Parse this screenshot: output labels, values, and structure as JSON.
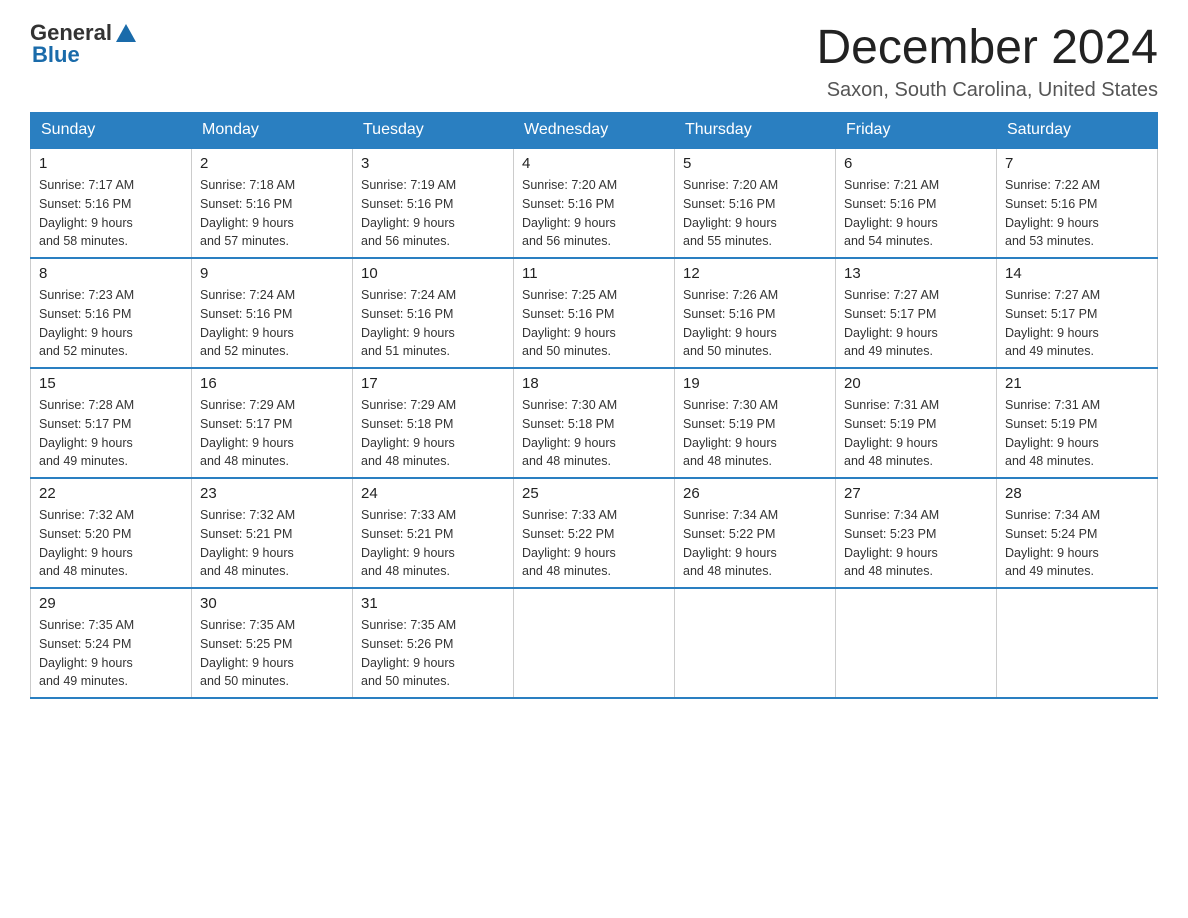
{
  "logo": {
    "general": "General",
    "blue": "Blue"
  },
  "title": "December 2024",
  "location": "Saxon, South Carolina, United States",
  "weekdays": [
    "Sunday",
    "Monday",
    "Tuesday",
    "Wednesday",
    "Thursday",
    "Friday",
    "Saturday"
  ],
  "weeks": [
    [
      {
        "day": "1",
        "sunrise": "7:17 AM",
        "sunset": "5:16 PM",
        "daylight": "9 hours and 58 minutes."
      },
      {
        "day": "2",
        "sunrise": "7:18 AM",
        "sunset": "5:16 PM",
        "daylight": "9 hours and 57 minutes."
      },
      {
        "day": "3",
        "sunrise": "7:19 AM",
        "sunset": "5:16 PM",
        "daylight": "9 hours and 56 minutes."
      },
      {
        "day": "4",
        "sunrise": "7:20 AM",
        "sunset": "5:16 PM",
        "daylight": "9 hours and 56 minutes."
      },
      {
        "day": "5",
        "sunrise": "7:20 AM",
        "sunset": "5:16 PM",
        "daylight": "9 hours and 55 minutes."
      },
      {
        "day": "6",
        "sunrise": "7:21 AM",
        "sunset": "5:16 PM",
        "daylight": "9 hours and 54 minutes."
      },
      {
        "day": "7",
        "sunrise": "7:22 AM",
        "sunset": "5:16 PM",
        "daylight": "9 hours and 53 minutes."
      }
    ],
    [
      {
        "day": "8",
        "sunrise": "7:23 AM",
        "sunset": "5:16 PM",
        "daylight": "9 hours and 52 minutes."
      },
      {
        "day": "9",
        "sunrise": "7:24 AM",
        "sunset": "5:16 PM",
        "daylight": "9 hours and 52 minutes."
      },
      {
        "day": "10",
        "sunrise": "7:24 AM",
        "sunset": "5:16 PM",
        "daylight": "9 hours and 51 minutes."
      },
      {
        "day": "11",
        "sunrise": "7:25 AM",
        "sunset": "5:16 PM",
        "daylight": "9 hours and 50 minutes."
      },
      {
        "day": "12",
        "sunrise": "7:26 AM",
        "sunset": "5:16 PM",
        "daylight": "9 hours and 50 minutes."
      },
      {
        "day": "13",
        "sunrise": "7:27 AM",
        "sunset": "5:17 PM",
        "daylight": "9 hours and 49 minutes."
      },
      {
        "day": "14",
        "sunrise": "7:27 AM",
        "sunset": "5:17 PM",
        "daylight": "9 hours and 49 minutes."
      }
    ],
    [
      {
        "day": "15",
        "sunrise": "7:28 AM",
        "sunset": "5:17 PM",
        "daylight": "9 hours and 49 minutes."
      },
      {
        "day": "16",
        "sunrise": "7:29 AM",
        "sunset": "5:17 PM",
        "daylight": "9 hours and 48 minutes."
      },
      {
        "day": "17",
        "sunrise": "7:29 AM",
        "sunset": "5:18 PM",
        "daylight": "9 hours and 48 minutes."
      },
      {
        "day": "18",
        "sunrise": "7:30 AM",
        "sunset": "5:18 PM",
        "daylight": "9 hours and 48 minutes."
      },
      {
        "day": "19",
        "sunrise": "7:30 AM",
        "sunset": "5:19 PM",
        "daylight": "9 hours and 48 minutes."
      },
      {
        "day": "20",
        "sunrise": "7:31 AM",
        "sunset": "5:19 PM",
        "daylight": "9 hours and 48 minutes."
      },
      {
        "day": "21",
        "sunrise": "7:31 AM",
        "sunset": "5:19 PM",
        "daylight": "9 hours and 48 minutes."
      }
    ],
    [
      {
        "day": "22",
        "sunrise": "7:32 AM",
        "sunset": "5:20 PM",
        "daylight": "9 hours and 48 minutes."
      },
      {
        "day": "23",
        "sunrise": "7:32 AM",
        "sunset": "5:21 PM",
        "daylight": "9 hours and 48 minutes."
      },
      {
        "day": "24",
        "sunrise": "7:33 AM",
        "sunset": "5:21 PM",
        "daylight": "9 hours and 48 minutes."
      },
      {
        "day": "25",
        "sunrise": "7:33 AM",
        "sunset": "5:22 PM",
        "daylight": "9 hours and 48 minutes."
      },
      {
        "day": "26",
        "sunrise": "7:34 AM",
        "sunset": "5:22 PM",
        "daylight": "9 hours and 48 minutes."
      },
      {
        "day": "27",
        "sunrise": "7:34 AM",
        "sunset": "5:23 PM",
        "daylight": "9 hours and 48 minutes."
      },
      {
        "day": "28",
        "sunrise": "7:34 AM",
        "sunset": "5:24 PM",
        "daylight": "9 hours and 49 minutes."
      }
    ],
    [
      {
        "day": "29",
        "sunrise": "7:35 AM",
        "sunset": "5:24 PM",
        "daylight": "9 hours and 49 minutes."
      },
      {
        "day": "30",
        "sunrise": "7:35 AM",
        "sunset": "5:25 PM",
        "daylight": "9 hours and 50 minutes."
      },
      {
        "day": "31",
        "sunrise": "7:35 AM",
        "sunset": "5:26 PM",
        "daylight": "9 hours and 50 minutes."
      },
      null,
      null,
      null,
      null
    ]
  ],
  "labels": {
    "sunrise": "Sunrise:",
    "sunset": "Sunset:",
    "daylight": "Daylight:"
  }
}
